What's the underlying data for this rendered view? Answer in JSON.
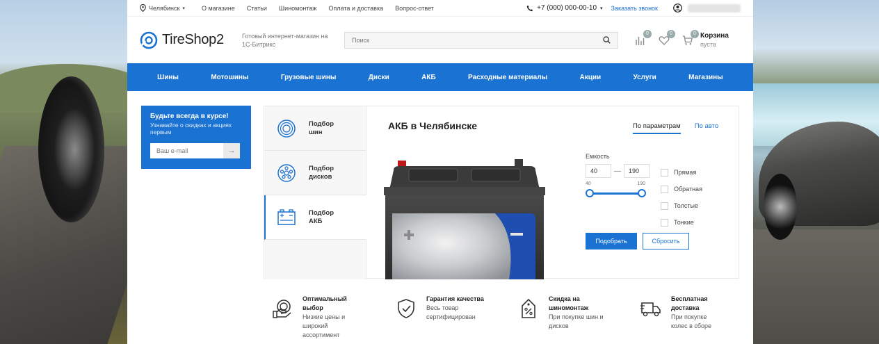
{
  "topbar": {
    "city": "Челябинск",
    "links": [
      "О магазине",
      "Статьи",
      "Шиномонтаж",
      "Оплата и доставка",
      "Вопрос-ответ"
    ],
    "phone": "+7 (000) 000-00-10",
    "callback": "Заказать звонок"
  },
  "header": {
    "logo": "TireShop2",
    "slogan": "Готовый интернет-магазин на 1С-Битрикс",
    "search_placeholder": "Поиск",
    "compare_count": "0",
    "favorites_count": "0",
    "cart_count": "0",
    "cart_title": "Корзина",
    "cart_status": "пуста"
  },
  "nav": [
    "Шины",
    "Мотошины",
    "Грузовые шины",
    "Диски",
    "АКБ",
    "Расходные материалы",
    "Акции",
    "Услуги",
    "Магазины"
  ],
  "subscribe": {
    "title": "Будьте всегда в курсе!",
    "subtitle": "Узнавайте о скидках и акциях первым",
    "email_placeholder": "Ваш e-mail"
  },
  "picker": {
    "tabs": [
      {
        "label": "Подбор шин",
        "icon": "tire-icon"
      },
      {
        "label": "Подбор дисков",
        "icon": "wheel-disc-icon"
      },
      {
        "label": "Подбор АКБ",
        "icon": "battery-icon"
      }
    ],
    "active_tab": 2,
    "title": "АКБ в Челябинске",
    "mode_tabs": [
      "По параметрам",
      "По авто"
    ],
    "capacity_label": "Емкость",
    "capacity_from": "40",
    "capacity_to": "190",
    "scale_min": "40",
    "scale_max": "190",
    "polarity_options": [
      "Прямая",
      "Обратная",
      "Толстые",
      "Тонкие"
    ],
    "submit_label": "Подобрать",
    "reset_label": "Сбросить"
  },
  "features": [
    {
      "title": "Оптимальный выбор",
      "text": "Низкие цены и широкий ассортимент",
      "icon": "choice-icon"
    },
    {
      "title": "Гарантия качества",
      "text": "Весь товар сертифицирован",
      "icon": "shield-check-icon"
    },
    {
      "title": "Скидка на шиномонтаж",
      "text": "При покупке шин и дисков",
      "icon": "discount-tag-icon"
    },
    {
      "title": "Бесплатная доставка",
      "text": "При покупке колес в сборе",
      "icon": "truck-icon"
    }
  ],
  "colors": {
    "accent": "#1a72d3"
  }
}
